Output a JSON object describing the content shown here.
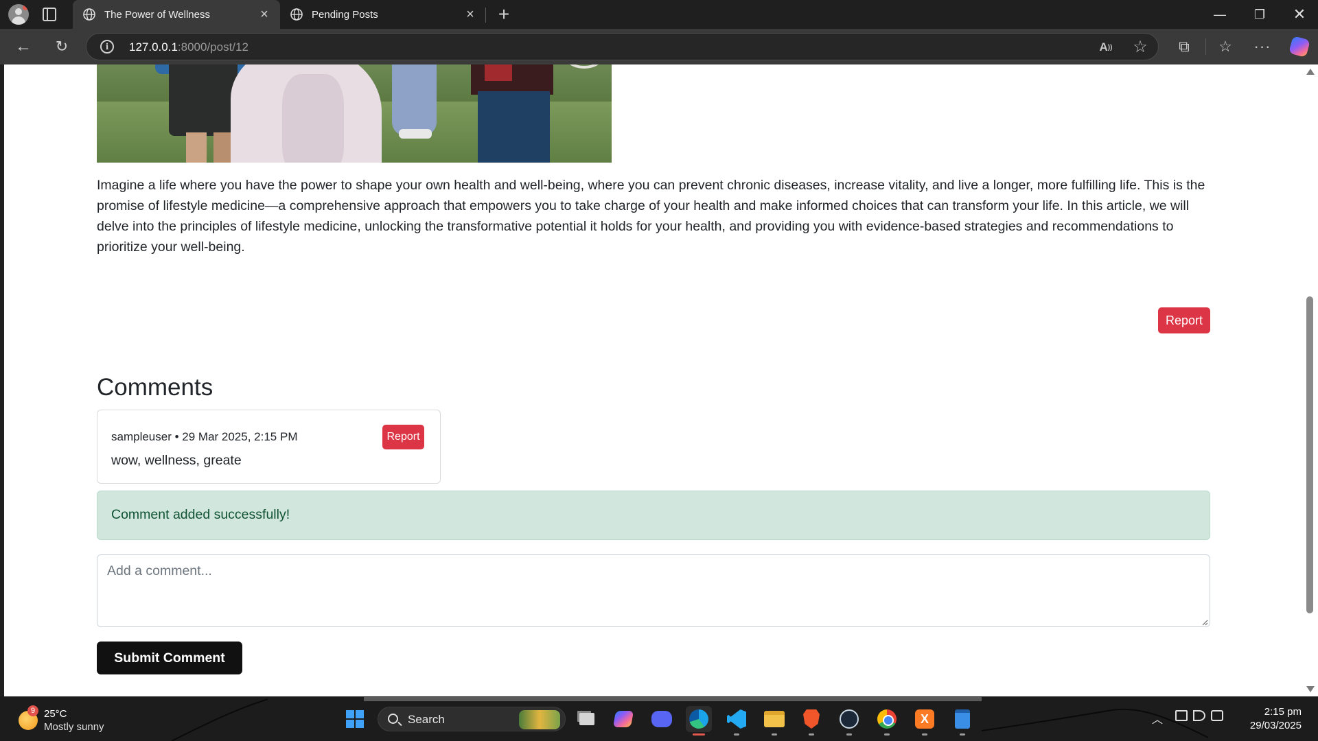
{
  "browser": {
    "tabs": [
      {
        "title": "The Power of Wellness",
        "active": true
      },
      {
        "title": "Pending Posts",
        "active": false
      }
    ],
    "url_host": "127.0.0.1",
    "url_rest": ":8000/post/12",
    "icons": {
      "profile": "profile-avatar-icon",
      "tab_actions": "tab-actions-icon",
      "back": "back-arrow-icon",
      "reload": "reload-icon",
      "site_info": "info-icon",
      "read_aloud": "read-aloud-icon",
      "favorite": "star-icon",
      "extensions": "puzzle-icon",
      "favorites": "favorites-icon",
      "more": "more-dots-icon",
      "copilot": "copilot-icon"
    }
  },
  "post": {
    "body": "Imagine a life where you have the power to shape your own health and well-being, where you can prevent chronic diseases, increase vitality, and live a longer, more fulfilling life. This is the promise of lifestyle medicine—a comprehensive approach that empowers you to take charge of your health and make informed choices that can transform your life. In this article, we will delve into the principles of lifestyle medicine, unlocking the transformative potential it holds for your health, and providing you with evidence-based strategies and recommendations to prioritize your well-being.",
    "report_label": "Report"
  },
  "comments": {
    "heading": "Comments",
    "items": [
      {
        "meta": "sampleuser • 29 Mar 2025, 2:15 PM",
        "text": "wow, wellness, greate",
        "report_label": "Report"
      }
    ],
    "success_message": "Comment added successfully!",
    "input_placeholder": "Add a comment...",
    "input_value": "",
    "submit_label": "Submit Comment"
  },
  "taskbar": {
    "weather": {
      "badge": "9",
      "temp": "25°C",
      "desc": "Mostly sunny"
    },
    "search_label": "Search",
    "xampp_glyph": "X",
    "clock": {
      "time": "2:15 pm",
      "date": "29/03/2025"
    }
  },
  "colors": {
    "danger": "#dc3545",
    "success_bg": "#d1e7dd",
    "success_text": "#0f5132",
    "submit_bg": "#111111"
  }
}
